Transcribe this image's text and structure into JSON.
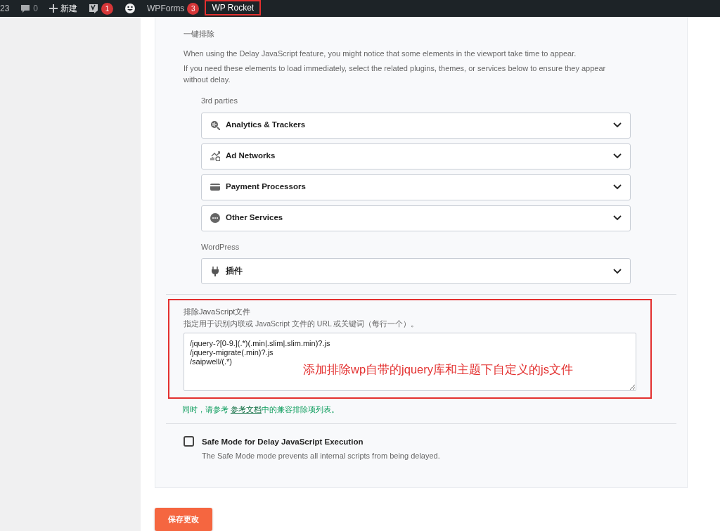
{
  "admin_bar": {
    "partial_count": "23",
    "comments": "0",
    "new_label": "新建",
    "seo_badge": "1",
    "wpforms_label": "WPForms",
    "wpforms_badge": "3",
    "rocket_label": "WP Rocket",
    "rocket_highlighted": true
  },
  "one_click": {
    "title": "一键排除",
    "intro": "When using the Delay JavaScript feature, you might notice that some elements in the viewport take time to appear.",
    "hint": "If you need these elements to load immediately, select the related plugins, themes, or services below to ensure they appear without delay."
  },
  "groups": [
    {
      "heading": "3rd parties",
      "items": [
        {
          "kind": "analytics",
          "label": "Analytics & Trackers",
          "expanded": false
        },
        {
          "kind": "ads",
          "label": "Ad Networks",
          "expanded": false
        },
        {
          "kind": "payment",
          "label": "Payment Processors",
          "expanded": false
        },
        {
          "kind": "other",
          "label": "Other Services",
          "expanded": false
        }
      ]
    },
    {
      "heading": "WordPress",
      "items": [
        {
          "kind": "plugin",
          "label": "插件",
          "expanded": false
        }
      ]
    }
  ],
  "exclude": {
    "title": "排除JavaScript文件",
    "description": "指定用于识别内联或 JavaScript 文件的 URL 或关键词（每行一个）。",
    "value": "/jquery-?[0-9.](.*)(.min|.slim|.slim.min)?.js\n/jquery-migrate(.min)?.js\n/saipwell/(.*)",
    "annotation": "添加排除wp自带的jquery库和主题下自定义的js文件",
    "highlighted": true,
    "help_before": "同时，请参考 ",
    "help_link": "参考文档",
    "help_after": "中的兼容排除项列表。"
  },
  "safe_mode": {
    "label": "Safe Mode for Delay JavaScript Execution",
    "description": "The Safe Mode mode prevents all internal scripts from being delayed.",
    "checked": false
  },
  "save_button": "保存更改"
}
